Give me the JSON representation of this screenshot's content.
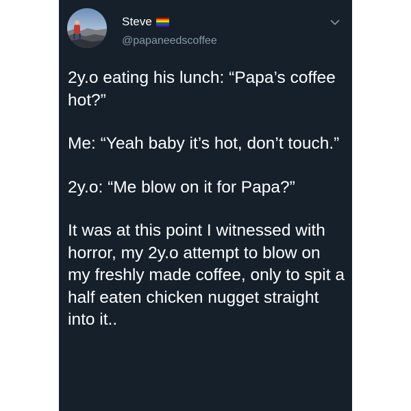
{
  "tweet": {
    "author": {
      "display_name": "Steve",
      "handle": "@papaneedscoffee",
      "badge_icon": "rainbow-flag-icon"
    },
    "menu_icon": "chevron-down-icon",
    "paragraphs": [
      "2y.o eating his lunch: “Papa’s coffee hot?”",
      "Me: “Yeah baby it’s hot, don’t touch.”",
      "2y.o: “Me blow on it for Papa?”",
      "It was at this point I witnessed with horror, my 2y.o attempt to blow on my freshly made coffee, only to spit a half eaten chicken nugget straight into it.."
    ]
  },
  "colors": {
    "background": "#15202b",
    "text_primary": "#ffffff",
    "text_secondary": "#8899a6",
    "page_margin": "#ffffff"
  }
}
